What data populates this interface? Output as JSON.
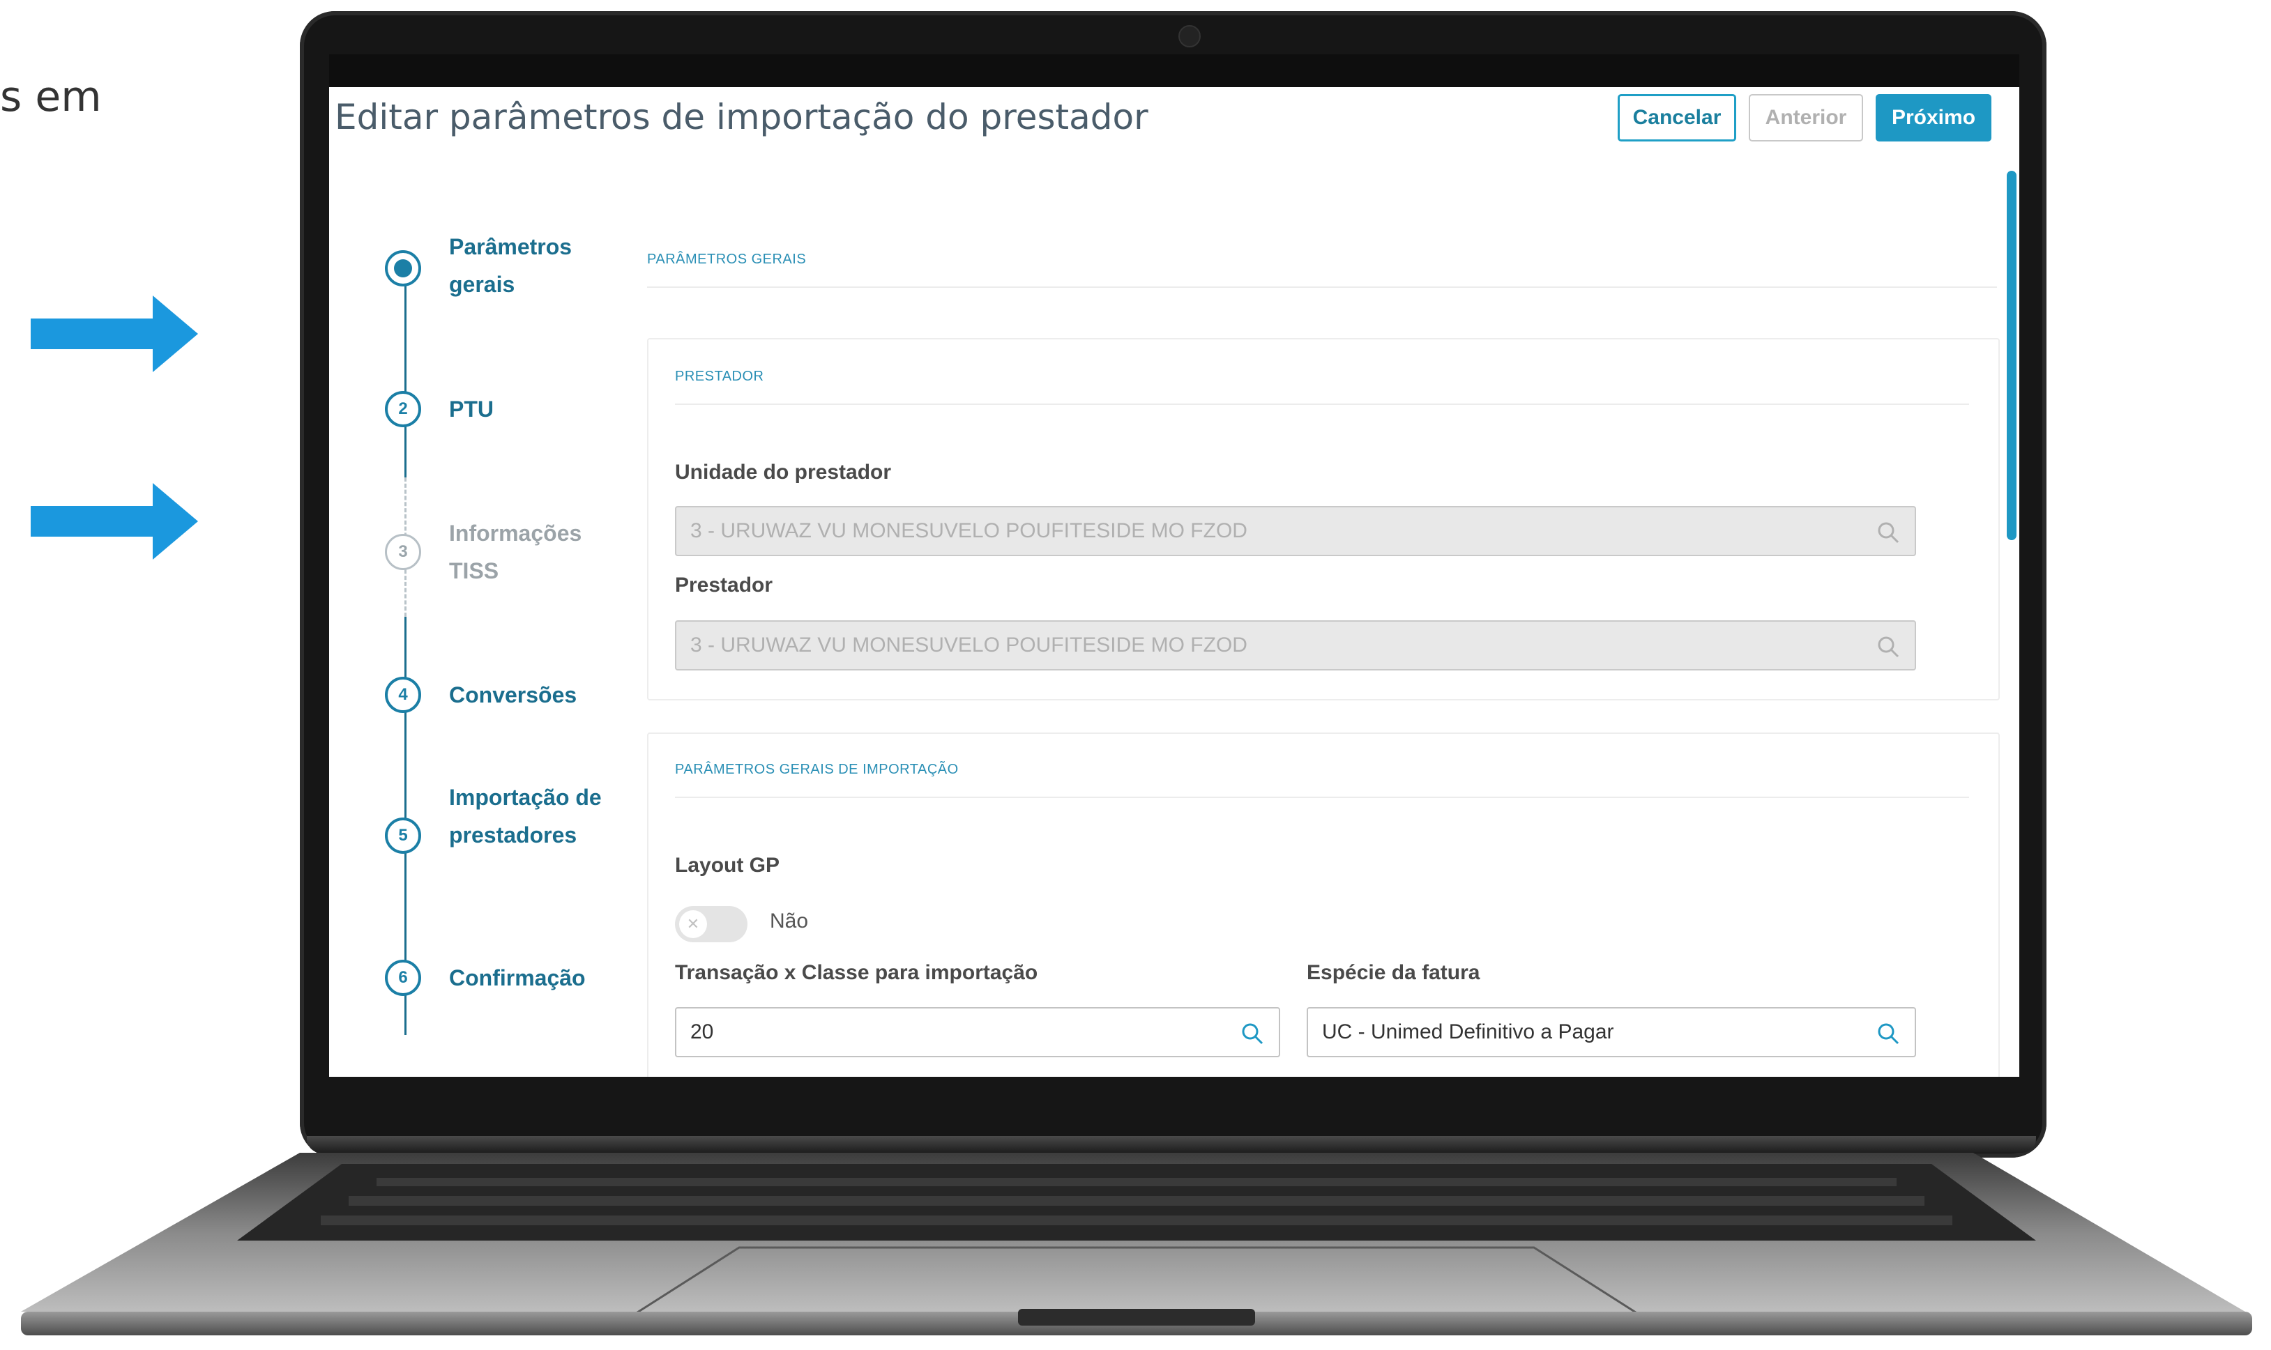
{
  "slide": {
    "partial_text": "s em"
  },
  "app": {
    "title": "Editar parâmetros de importação do prestador",
    "buttons": {
      "cancel": "Cancelar",
      "previous": "Anterior",
      "next": "Próximo"
    }
  },
  "steps": [
    {
      "number": "",
      "label": "Parâmetros gerais",
      "state": "active"
    },
    {
      "number": "2",
      "label": "PTU",
      "state": "enabled"
    },
    {
      "number": "3",
      "label": "Informações TISS",
      "state": "pending"
    },
    {
      "number": "4",
      "label": "Conversões",
      "state": "enabled"
    },
    {
      "number": "5",
      "label": "Importação de prestadores",
      "state": "enabled"
    },
    {
      "number": "6",
      "label": "Confirmação",
      "state": "enabled"
    }
  ],
  "form": {
    "section_title": "PARÂMETROS GERAIS",
    "prestador_card": {
      "title": "PRESTADOR",
      "unidade_label": "Unidade do prestador",
      "unidade_value": "3 - URUWAZ VU MONESUVELO POUFITESIDE MO FZOD",
      "prestador_label": "Prestador",
      "prestador_value": "3 - URUWAZ VU MONESUVELO POUFITESIDE MO FZOD"
    },
    "import_card": {
      "title": "PARÂMETROS GERAIS DE IMPORTAÇÃO",
      "layout_label": "Layout GP",
      "layout_toggle_text": "Não",
      "layout_toggle_on": false,
      "transacao_label": "Transação x Classe para importação",
      "transacao_value": "20",
      "especie_label": "Espécie da fatura",
      "especie_value": "UC - Unimed Definitivo a Pagar"
    }
  },
  "colors": {
    "accent": "#1e98c4",
    "arrow": "#1b98de",
    "step_active": "#1b7fa6"
  }
}
